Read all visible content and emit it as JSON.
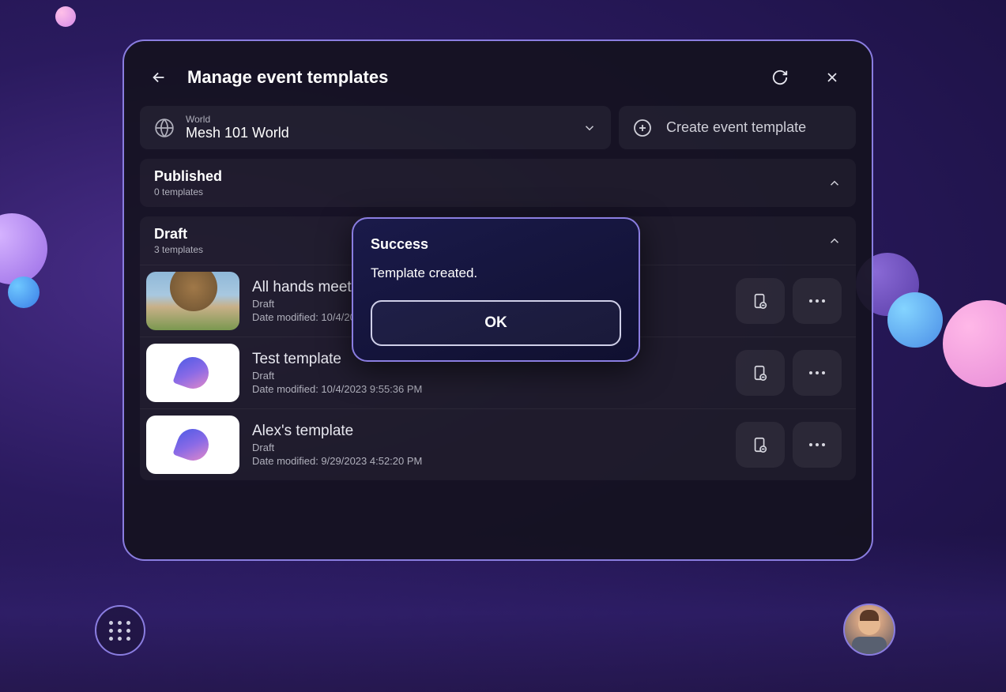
{
  "header": {
    "title": "Manage event templates"
  },
  "world_selector": {
    "label": "World",
    "value": "Mesh 101 World"
  },
  "create_button": "Create event template",
  "sections": {
    "published": {
      "title": "Published",
      "subtitle": "0 templates"
    },
    "draft": {
      "title": "Draft",
      "subtitle": "3 templates"
    }
  },
  "templates": [
    {
      "name": "All hands meeting",
      "status": "Draft",
      "date_prefix": "Date modified: 10/4/20"
    },
    {
      "name": "Test template",
      "status": "Draft",
      "date_prefix": "Date modified: 10/4/2023 9:55:36 PM"
    },
    {
      "name": "Alex's template",
      "status": "Draft",
      "date_prefix": "Date modified: 9/29/2023 4:52:20 PM"
    }
  ],
  "dialog": {
    "title": "Success",
    "message": "Template created.",
    "ok": "OK"
  }
}
